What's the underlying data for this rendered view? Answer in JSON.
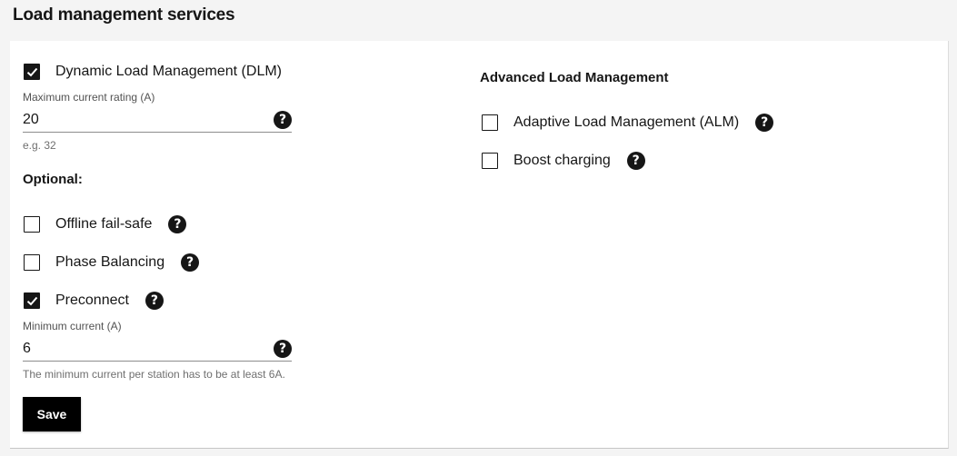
{
  "page": {
    "title": "Load management services"
  },
  "dlm": {
    "label": "Dynamic Load Management (DLM)",
    "checked": true,
    "max_current_label": "Maximum current rating (A)",
    "max_current_value": "20",
    "max_current_helper": "e.g. 32"
  },
  "optional": {
    "heading": "Optional:",
    "offline_failsafe": {
      "label": "Offline fail-safe",
      "checked": false
    },
    "phase_balancing": {
      "label": "Phase Balancing",
      "checked": false
    },
    "preconnect": {
      "label": "Preconnect",
      "checked": true
    },
    "min_current_label": "Minimum current (A)",
    "min_current_value": "6",
    "min_current_helper": "The minimum current per station has to be at least 6A."
  },
  "advanced": {
    "heading": "Advanced Load Management",
    "alm": {
      "label": "Adaptive Load Management (ALM)",
      "checked": false
    },
    "boost": {
      "label": "Boost charging",
      "checked": false
    }
  },
  "actions": {
    "save_label": "Save"
  },
  "help_glyph": "?",
  "icons": {
    "checkmark": "checkmark-icon",
    "help": "help-icon"
  },
  "colors": {
    "primary": "#000000",
    "text": "#161616",
    "background": "#f4f4f4",
    "card": "#ffffff"
  }
}
